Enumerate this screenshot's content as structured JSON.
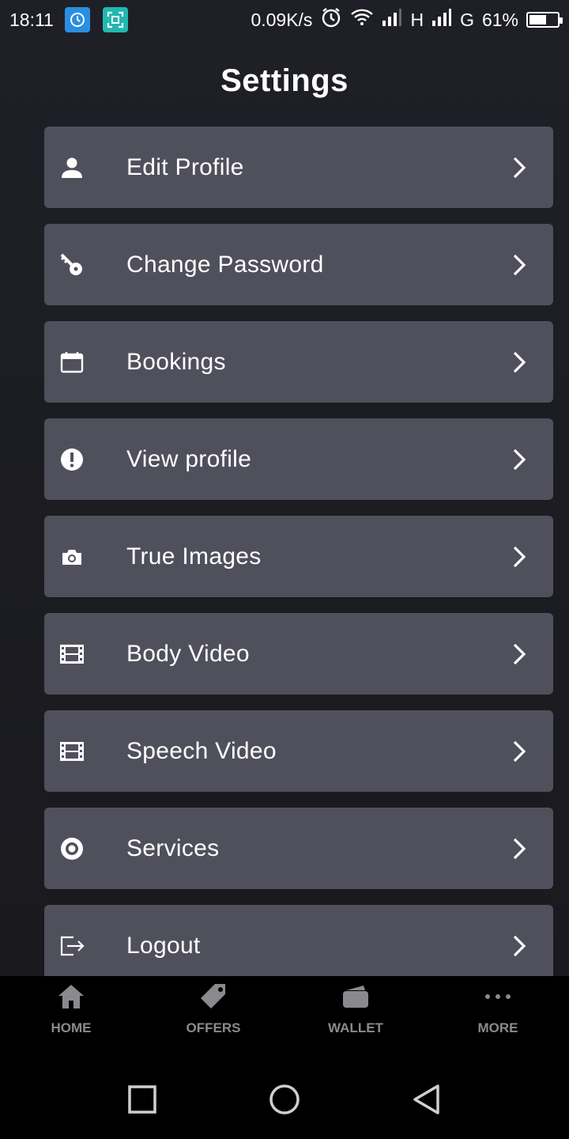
{
  "status_bar": {
    "time": "18:11",
    "net_speed": "0.09K/s",
    "signal_1": "H",
    "signal_2": "G",
    "battery": "61%",
    "battery_level": 0.61
  },
  "page": {
    "title": "Settings"
  },
  "menu": [
    {
      "label": "Edit Profile",
      "icon": "person-icon"
    },
    {
      "label": "Change Password",
      "icon": "key-icon"
    },
    {
      "label": "Bookings",
      "icon": "calendar-icon"
    },
    {
      "label": "View profile",
      "icon": "exclamation-circle-icon"
    },
    {
      "label": "True Images",
      "icon": "camera-icon"
    },
    {
      "label": "Body Video",
      "icon": "film-icon"
    },
    {
      "label": "Speech Video",
      "icon": "film-icon"
    },
    {
      "label": "Services",
      "icon": "target-icon"
    },
    {
      "label": "Logout",
      "icon": "logout-icon"
    }
  ],
  "bottom_nav": {
    "home": "HOME",
    "offers": "OFFERS",
    "wallet": "WALLET",
    "more": "MORE"
  },
  "colors": {
    "background": "#1b1c22",
    "card": "#50505d",
    "nav_inactive": "#8a8a8e"
  }
}
